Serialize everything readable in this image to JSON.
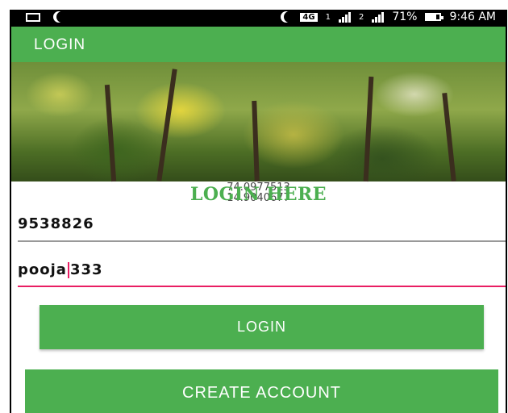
{
  "status_bar": {
    "battery_percent": "71%",
    "time": "9:46 AM",
    "network_badge": "4G",
    "sim1_label": "1",
    "sim2_label": "2",
    "icons": [
      "gallery-icon",
      "moon-icon",
      "moon-icon",
      "signal-icon",
      "battery-icon"
    ]
  },
  "app_bar": {
    "title": "LOGIN"
  },
  "banner": {
    "image": "forest-trees-banner"
  },
  "login_form": {
    "heading": "LOGIN HERE",
    "coord_line1": "74.0977513",
    "coord_line2": "14.9040677",
    "phone_value": "9538826",
    "password_before_cursor": "pooja",
    "password_after_cursor": "333",
    "login_button_label": "LOGIN",
    "create_account_label": "CREATE ACCOUNT"
  },
  "colors": {
    "primary": "#4caf50",
    "accent": "#e91e63",
    "status_bar": "#000000",
    "divider": "#999999"
  }
}
